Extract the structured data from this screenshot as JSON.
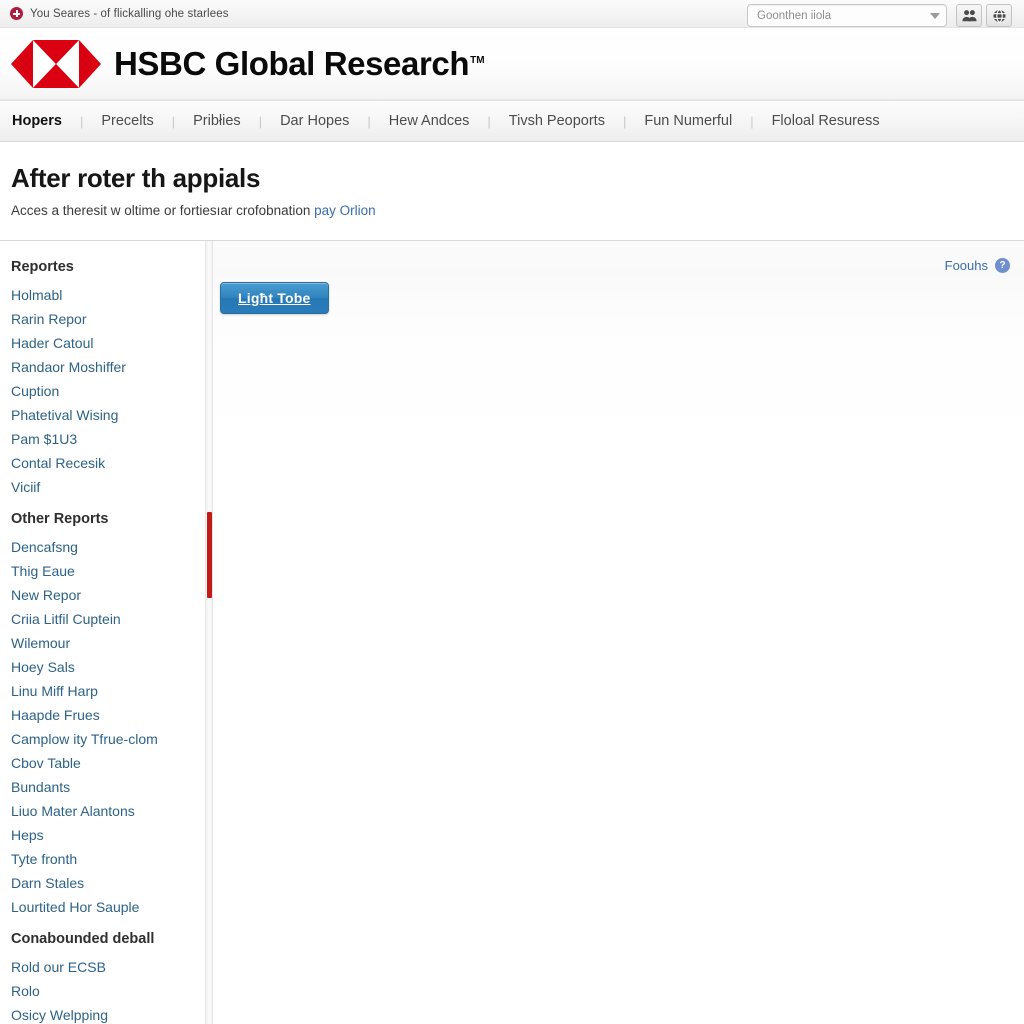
{
  "topbar": {
    "alert_icon": "alert-plus-icon",
    "message": "You Seares - of flickalling ohe starlees"
  },
  "search": {
    "value": "Goonthen iiola",
    "dropdown_icon": "chevron-down-icon",
    "people_button_icon": "people-icon",
    "globe_button_icon": "globe-refresh-icon"
  },
  "brand": {
    "logo_icon": "hsbc-hexagon-logo",
    "name": "HSBC Global Research",
    "trademark": "TM",
    "logo_color": "#db0011"
  },
  "nav": {
    "separator": "|",
    "items": [
      {
        "label": "Hopers",
        "active": true
      },
      {
        "label": "Precelts",
        "active": false
      },
      {
        "label": "Pribłies",
        "active": false
      },
      {
        "label": "Dar Hopes",
        "active": false
      },
      {
        "label": "Hew Andces",
        "active": false
      },
      {
        "label": "Tivsh Peoports",
        "active": false
      },
      {
        "label": "Fun Numerful",
        "active": false
      },
      {
        "label": "Floloal Resuress",
        "active": false
      }
    ]
  },
  "page": {
    "title": "After roter th appials",
    "subtitle": "Acces a theresit w oltime or fortiesıar crofobnation",
    "subtitle_link": "pay Orlion"
  },
  "sidebar": {
    "groups": [
      {
        "header": "Reportes",
        "items": [
          "Holmabl",
          "Rarin Repor",
          "Hader Catoul",
          "Randaor Moshiffer",
          "Cuption",
          "Phatetival Wising",
          "Pam $1U3",
          "Contal Recesik",
          "Viciif"
        ]
      },
      {
        "header": "Other Reports",
        "items": [
          "Dencafsng",
          "Thig Eaue",
          "New Repor",
          "Criia Litfil Cuptein",
          "Wilemour",
          "Hoey Sals",
          "Linu Miff Harp",
          "Haapde Frues",
          "Camplow ity Tfrue-clom",
          "Cbov Table",
          "Bundants",
          "Liuo Mater Alantons",
          "Heps",
          "Tyte fronth",
          "Darn Stales",
          "Lourtited Hor Sauple"
        ]
      },
      {
        "header": "Conabounded deball",
        "items": [
          "Rold our ECSB",
          "Rolo",
          "Osicy Welpping"
        ]
      }
    ],
    "scrollbar": {
      "thumb_color": "#c21b17"
    }
  },
  "content": {
    "top_link": "Foouhs",
    "help_icon": "help-question-icon",
    "help_glyph": "?",
    "primary_button": "Ligħt Tobe",
    "accent_color": "#2678b4",
    "link_color": "#3a6cab"
  }
}
